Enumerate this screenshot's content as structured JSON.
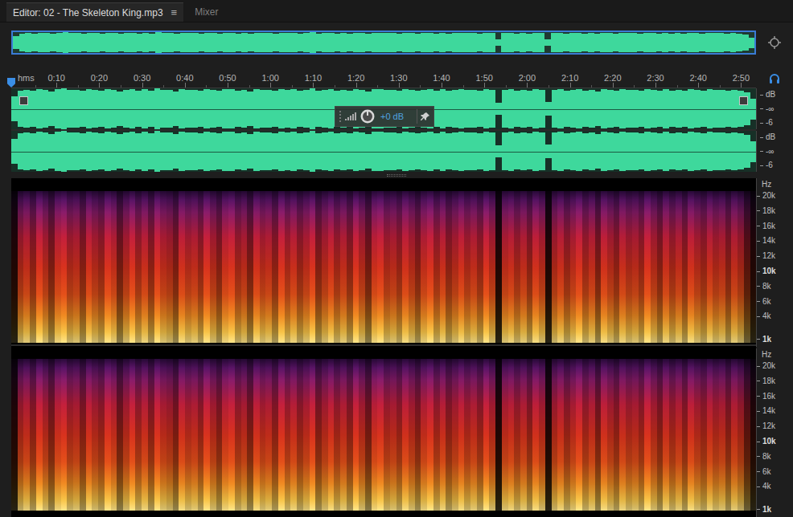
{
  "tabs": [
    {
      "label": "Editor: 02 - The Skeleton King.mp3",
      "menu_icon": "≡",
      "selected": true
    },
    {
      "label": "Mixer",
      "selected": false
    }
  ],
  "timeline": {
    "unit": "hms",
    "ticks": [
      "0:10",
      "0:20",
      "0:30",
      "0:40",
      "0:50",
      "1:00",
      "1:10",
      "1:20",
      "1:30",
      "1:40",
      "1:50",
      "2:00",
      "2:10",
      "2:20",
      "2:30",
      "2:40",
      "2:50"
    ]
  },
  "hud": {
    "reading": "+0 dB"
  },
  "channels": [
    {
      "scale": [
        "dB",
        "-∞",
        "-6"
      ]
    },
    {
      "scale": [
        "dB",
        "-∞",
        "-6"
      ]
    }
  ],
  "spectrogram": {
    "unit": "Hz",
    "ticks": [
      "20k",
      "18k",
      "16k",
      "14k",
      "12k",
      "10k",
      "8k",
      "6k",
      "4k",
      "1k"
    ]
  },
  "waveform": {
    "values": [
      0.6,
      0.88,
      0.92,
      0.86,
      0.95,
      0.9,
      0.84,
      0.93,
      0.97,
      0.89,
      0.91,
      0.85,
      0.94,
      0.9,
      0.87,
      0.96,
      0.92,
      0.83,
      0.9,
      0.95,
      0.88,
      0.93,
      0.86,
      0.97,
      0.91,
      0.89,
      0.84,
      0.94,
      0.9,
      0.92,
      0.87,
      0.95,
      0.9,
      0.85,
      0.93,
      0.96,
      0.88,
      0.91,
      0.84,
      0.94,
      0.9,
      0.92,
      0.86,
      0.95,
      0.89,
      0.93,
      0.87,
      0.91,
      0.97,
      0.85,
      0.9,
      0.94,
      0.88,
      0.92,
      0.86,
      0.95,
      0.9,
      0.83,
      0.93,
      0.96,
      0.89,
      0.91,
      0.87,
      0.94,
      0.9,
      0.85,
      0.92,
      0.95,
      0.88,
      0.93,
      0.86,
      0.9,
      0.94,
      0.89,
      0.92,
      0.87,
      0.95,
      0.9,
      0.3,
      0.91,
      0.93,
      0.88,
      0.92,
      0.86,
      0.94,
      0.9,
      0.32,
      0.89,
      0.93,
      0.87,
      0.91,
      0.95,
      0.88,
      0.92,
      0.84,
      0.94,
      0.9,
      0.86,
      0.93,
      0.89,
      0.91,
      0.87,
      0.95,
      0.9,
      0.85,
      0.93,
      0.88,
      0.92,
      0.86,
      0.94,
      0.9,
      0.87,
      0.93,
      0.89,
      0.91,
      0.85,
      0.92,
      0.88,
      0.8,
      0.5
    ]
  }
}
